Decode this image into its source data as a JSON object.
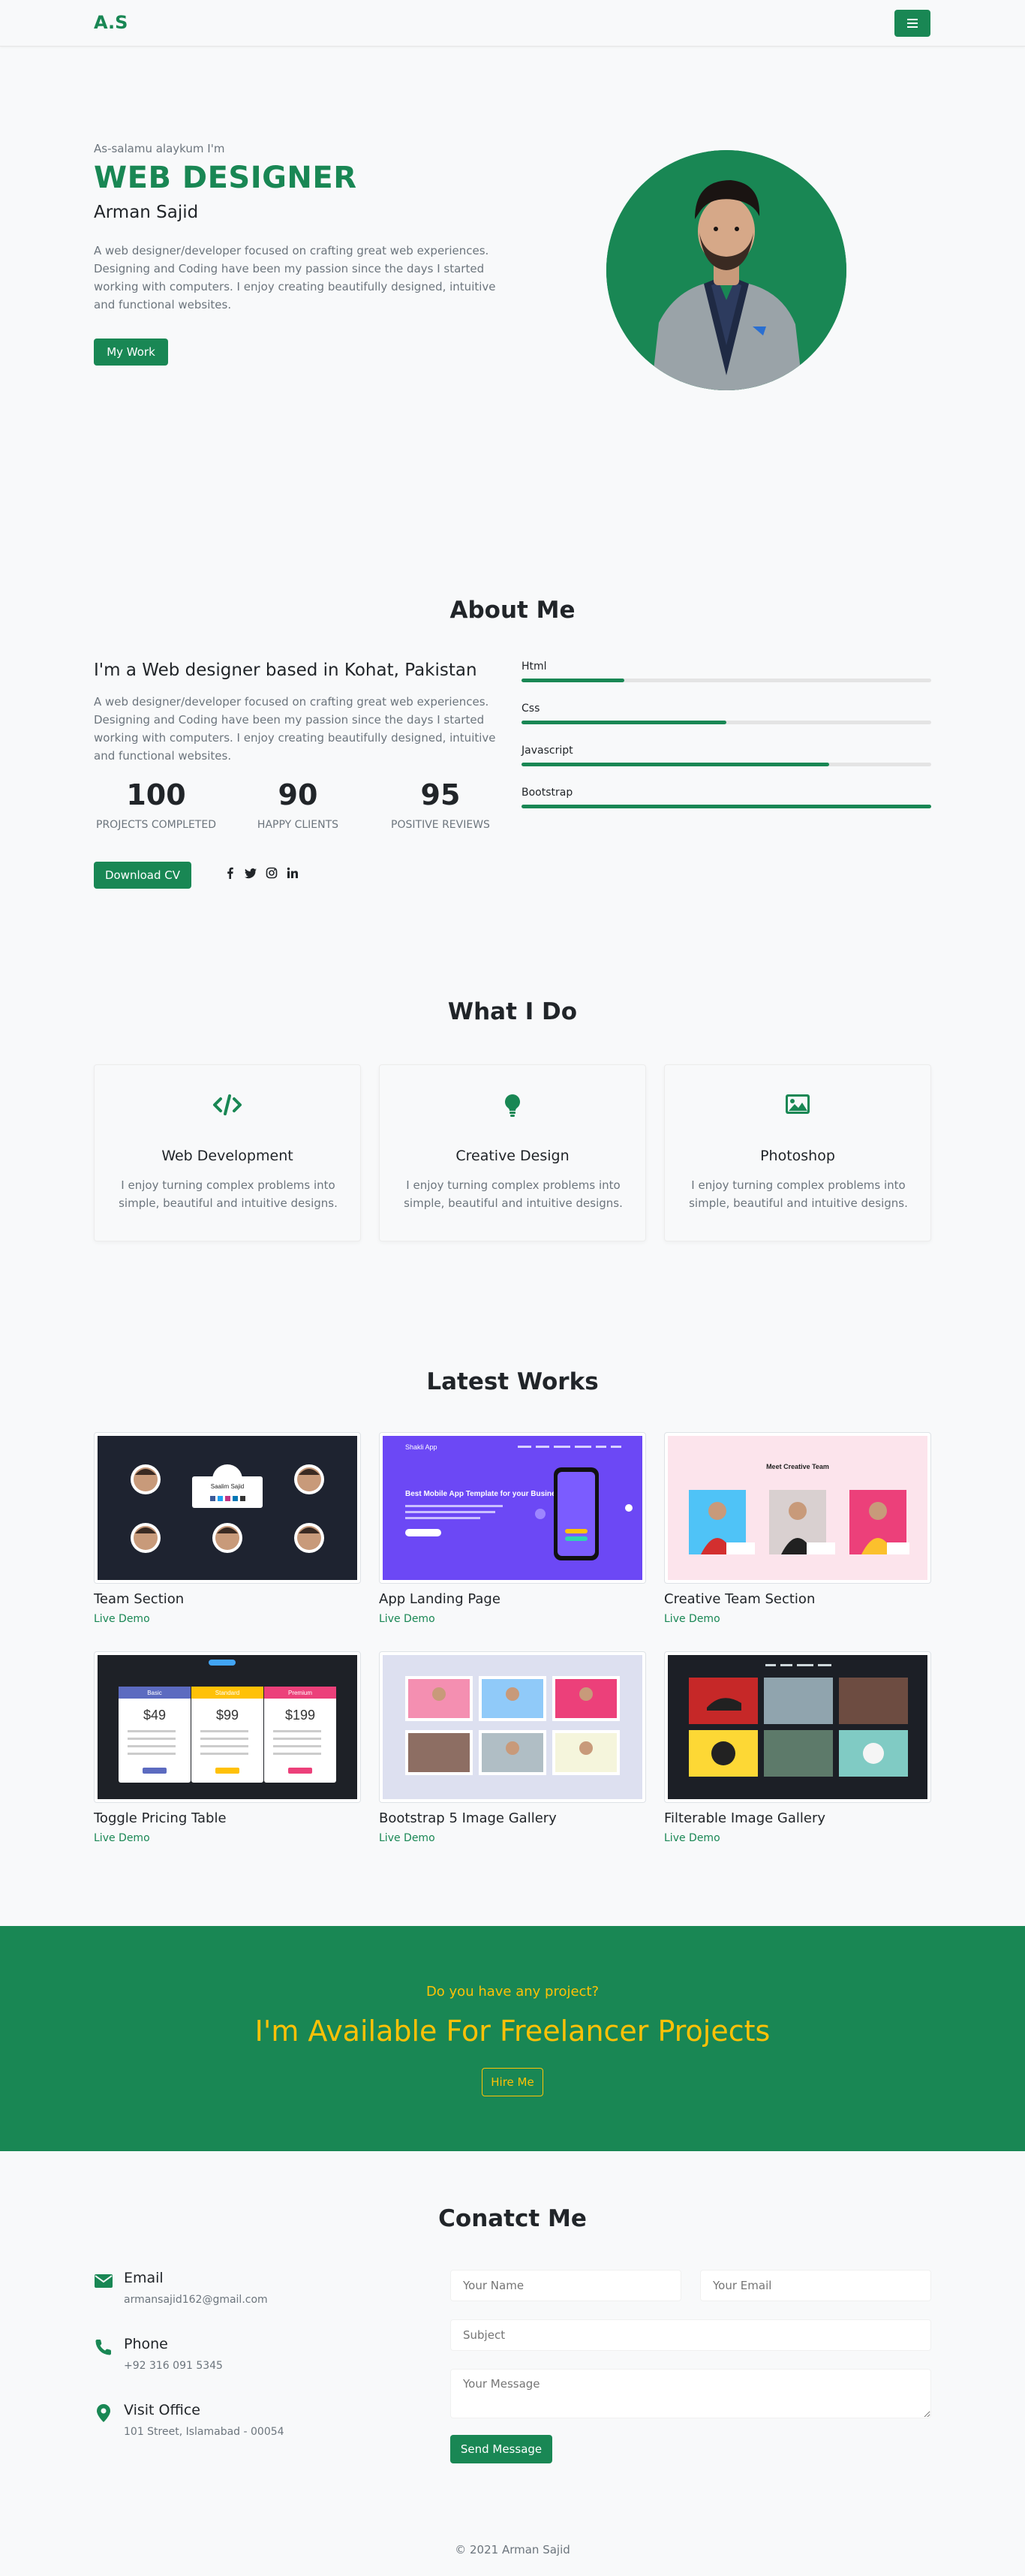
{
  "nav": {
    "brand": "A.S",
    "toggler_icon": "hamburger-icon"
  },
  "hero": {
    "greeting": "As-salamu alaykum I'm",
    "title": "WEB DESIGNER",
    "name": "Arman Sajid",
    "description": "A web designer/developer focused on crafting great web experiences. Designing and Coding have been my passion since the days I started working with computers. I enjoy creating beautifully designed, intuitive and functional websites.",
    "button": "My Work"
  },
  "about": {
    "title": "About Me",
    "heading": "I'm a Web designer based in Kohat, Pakistan",
    "description": "A web designer/developer focused on crafting great web experiences. Designing and Coding have been my passion since the days I started working with computers. I enjoy creating beautifully designed, intuitive and functional websites.",
    "stats": [
      {
        "value": "100",
        "label": "PROJECTS COMPLETED"
      },
      {
        "value": "90",
        "label": "HAPPY CLIENTS"
      },
      {
        "value": "95",
        "label": "POSITIVE REVIEWS"
      }
    ],
    "cv_button": "Download CV",
    "socials": [
      "facebook-icon",
      "twitter-icon",
      "instagram-icon",
      "linkedin-icon"
    ],
    "skills": [
      {
        "name": "Html",
        "level": 0.25
      },
      {
        "name": "Css",
        "level": 0.5
      },
      {
        "name": "Javascript",
        "level": 0.75
      },
      {
        "name": "Bootstrap",
        "level": 1.0
      }
    ]
  },
  "services": {
    "title": "What I Do",
    "items": [
      {
        "icon": "code-icon",
        "title": "Web Development",
        "desc": "I enjoy turning complex problems into simple, beautiful and intuitive designs."
      },
      {
        "icon": "lightbulb-icon",
        "title": "Creative Design",
        "desc": "I enjoy turning complex problems into simple, beautiful and intuitive designs."
      },
      {
        "icon": "image-icon",
        "title": "Photoshop",
        "desc": "I enjoy turning complex problems into simple, beautiful and intuitive designs."
      }
    ]
  },
  "works": {
    "title": "Latest Works",
    "items": [
      {
        "title": "Team Section",
        "link": "Live Demo"
      },
      {
        "title": "App Landing Page",
        "link": "Live Demo"
      },
      {
        "title": "Creative Team Section",
        "link": "Live Demo"
      },
      {
        "title": "Toggle Pricing Table",
        "link": "Live Demo"
      },
      {
        "title": "Bootstrap 5 Image Gallery",
        "link": "Live Demo"
      },
      {
        "title": "Filterable Image Gallery",
        "link": "Live Demo"
      }
    ],
    "thumbs": {
      "team_popup_name": "Saalim Sajid",
      "app_brand": "Shakli App",
      "app_heading": "Best Mobile App Template for your Business",
      "creative_heading": "Meet Creative Team",
      "pricing": [
        {
          "plan": "Basic",
          "price": "$49"
        },
        {
          "plan": "Standard",
          "price": "$99"
        },
        {
          "plan": "Premium",
          "price": "$199"
        }
      ]
    }
  },
  "cta": {
    "subtitle": "Do you have any project?",
    "title": "I'm Available For Freelancer Projects",
    "button": "Hire Me"
  },
  "contact": {
    "title": "Conatct Me",
    "items": [
      {
        "icon": "envelope-icon",
        "title": "Email",
        "value": "armansajid162@gmail.com"
      },
      {
        "icon": "phone-icon",
        "title": "Phone",
        "value": "+92 316 091 5345"
      },
      {
        "icon": "map-marker-icon",
        "title": "Visit Office",
        "value": "101 Street, Islamabad - 00054"
      }
    ],
    "form": {
      "name_placeholder": "Your Name",
      "email_placeholder": "Your Email",
      "subject_placeholder": "Subject",
      "message_placeholder": "Your Message",
      "send_button": "Send Message"
    }
  },
  "footer": {
    "copyright": "© 2021 Arman Sajid"
  },
  "colors": {
    "accent": "#198754",
    "highlight": "#ffc107",
    "muted": "#6c757d"
  }
}
